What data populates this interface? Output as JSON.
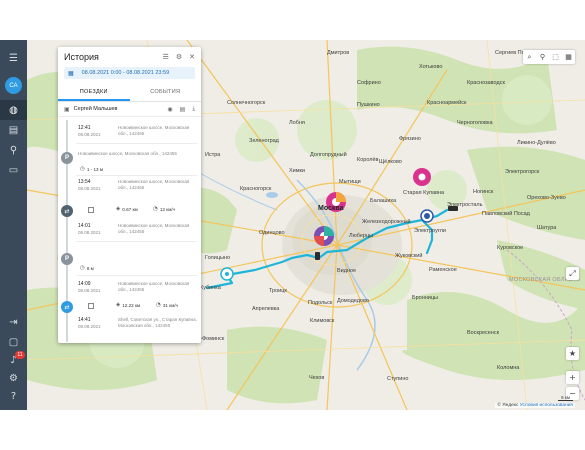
{
  "rail": {
    "avatar": "СА",
    "notifications_badge": "11"
  },
  "panel": {
    "title": "История",
    "date_range": "08.08.2021 0:00 - 08.08.2021 23:59",
    "tabs": [
      {
        "label": "ПОЕЗДКИ",
        "active": true
      },
      {
        "label": "СОБЫТИЯ",
        "active": false
      }
    ],
    "driver_name": "Сергей Мальшев",
    "entries": [
      {
        "time": "12:41",
        "date": "08.08.2021",
        "address": "Новоивинское шоссе, Московская обл., 142455"
      },
      {
        "kind": "parking",
        "address": "Новоивинское шоссе, Московская обл., 142455",
        "duration": "1 - 13",
        "duration_unit": "м"
      },
      {
        "time": "13:54",
        "date": "08.08.2021",
        "address": "Новоивинское шоссе, Московская обл., 142455"
      },
      {
        "kind": "trip",
        "distance": "0.67",
        "distance_unit": "км",
        "speed": "12",
        "speed_unit": "км/ч"
      },
      {
        "time": "14:01",
        "date": "08.08.2021",
        "address": "Новоивинское шоссе, Московская обл., 142455"
      },
      {
        "kind": "parking",
        "duration": "8",
        "duration_unit": "м"
      },
      {
        "time": "14:09",
        "date": "08.08.2021",
        "address": "Новоивинское шоссе, Московская обл., 142455"
      },
      {
        "kind": "trip",
        "distance": "12.22",
        "distance_unit": "км",
        "speed": "31",
        "speed_unit": "км/ч"
      },
      {
        "time": "14:41",
        "date": "08.08.2021",
        "address": "Shell, Советская ул., Старая Купавна, Московская обл., 142450"
      }
    ]
  },
  "map": {
    "labels": {
      "moscow": "Москва",
      "mytishchi": "Мытищи",
      "balashikha": "Балашиха",
      "lyubertsy": "Люберцы",
      "zhukovsky": "Жуковский",
      "ramenskoye": "Раменское",
      "podolsk": "Подольск",
      "domodedovo": "Домодедово",
      "troitsk": "Троицк",
      "odintsovo": "Одинцово",
      "krasnogorsk": "Красногорск",
      "khimki": "Химки",
      "zelenograd": "Зеленоград",
      "shchyolkovo": "Щёлково",
      "fryazino": "Фрязино",
      "korolyov": "Королёв",
      "pushkino": "Пушкино",
      "sofrino": "Софрино",
      "noginsk": "Ногинск",
      "elektrostal": "Электросталь",
      "elektrougli": "Электроугли",
      "zheleznodorozhny": "Железнодорожный",
      "staraya_kupavna": "Старая Купавна",
      "pavlovsky_posad": "Павловский Посад",
      "elektrogorsk": "Электрогорск",
      "bronnitsy": "Бронницы",
      "vidnoye": "Видное",
      "klimovsk": "Климовск",
      "chekhov": "Чехов",
      "lobnya": "Лобня",
      "dolgoprudny": "Долгопрудный",
      "moscow_oblast": "МОСКОВСКАЯ ОБЛАСТЬ",
      "sergiev_posad": "Сергиев Посад",
      "khotkovo": "Хотьково",
      "krasnoarmeysk": "Красноармейск",
      "golitsyno": "Голицыно",
      "aprelevka": "Апрелевка",
      "naro_fominsk": "Наро-Фоминск",
      "kubinka": "Кубинка",
      "istra": "Истра",
      "solnechnogorsk": "Солнечногорск",
      "dmitrov": "Дмитров",
      "voskresensk": "Воскресенск",
      "kolomna": "Коломна",
      "stupino": "Ступино",
      "kurovskoye": "Куровское",
      "shatura": "Шатура",
      "orekhovo_zuevo": "Орехово-Зуево",
      "likino_dulyovo": "Ликино-Дулёво",
      "krasnozavodsk": "Краснозаводск",
      "chernogolovka": "Черноголовка"
    },
    "attribution_prefix": "© Яндекс",
    "attribution_link": "Условия использования",
    "scale": "5 км",
    "route_color": "#1fb5d9"
  }
}
